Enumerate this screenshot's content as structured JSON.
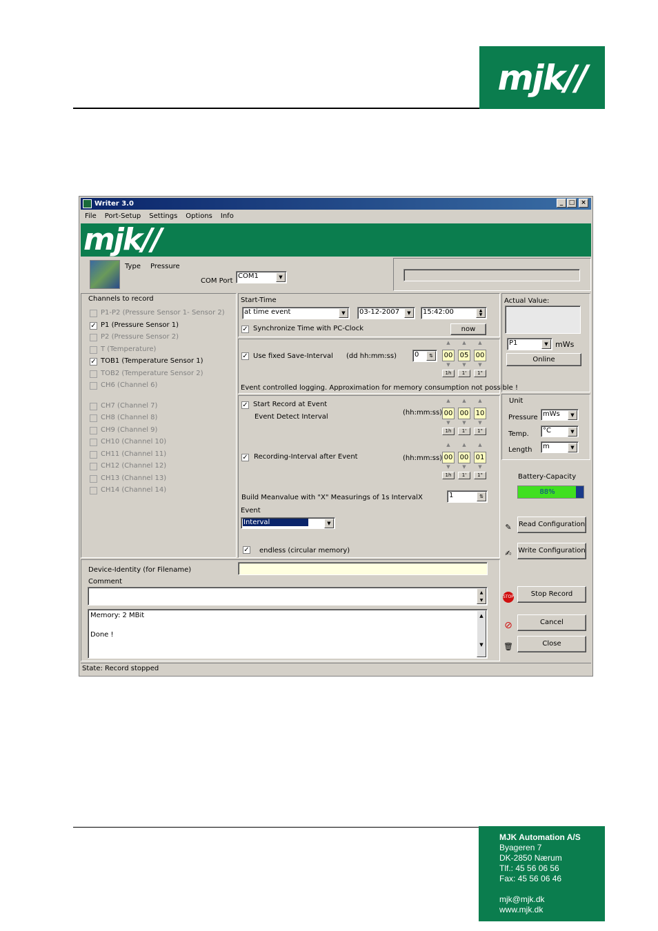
{
  "header": {
    "logo": "mjk//"
  },
  "window": {
    "title": "Writer 3.0",
    "controls": {
      "min": "_",
      "max": "□",
      "close": "×"
    },
    "menu": [
      "File",
      "Port-Setup",
      "Settings",
      "Options",
      "Info"
    ],
    "banner_logo": "mjk//",
    "type_label": "Type",
    "type_value": "Pressure",
    "com_label": "COM Port",
    "com_value": "COM1",
    "channels": {
      "title": "Channels to record",
      "items": [
        {
          "label": "P1-P2 (Pressure Sensor 1- Sensor 2)",
          "checked": false,
          "enabled": false
        },
        {
          "label": "P1 (Pressure Sensor 1)",
          "checked": true,
          "enabled": true
        },
        {
          "label": "P2 (Pressure Sensor 2)",
          "checked": false,
          "enabled": false
        },
        {
          "label": "T (Temperature)",
          "checked": false,
          "enabled": false
        },
        {
          "label": "TOB1 (Temperature Sensor 1)",
          "checked": true,
          "enabled": true
        },
        {
          "label": "TOB2 (Temperature Sensor 2)",
          "checked": false,
          "enabled": false
        },
        {
          "label": "CH6 (Channel 6)",
          "checked": false,
          "enabled": false
        },
        {
          "label": "CH7 (Channel 7)",
          "checked": false,
          "enabled": false
        },
        {
          "label": "CH8 (Channel 8)",
          "checked": false,
          "enabled": false
        },
        {
          "label": "CH9 (Channel 9)",
          "checked": false,
          "enabled": false
        },
        {
          "label": "CH10 (Channel 10)",
          "checked": false,
          "enabled": false
        },
        {
          "label": "CH11 (Channel 11)",
          "checked": false,
          "enabled": false
        },
        {
          "label": "CH12 (Channel 12)",
          "checked": false,
          "enabled": false
        },
        {
          "label": "CH13 (Channel 13)",
          "checked": false,
          "enabled": false
        },
        {
          "label": "CH14 (Channel 14)",
          "checked": false,
          "enabled": false
        }
      ]
    },
    "start": {
      "title": "Start-Time",
      "mode": "at time event",
      "date": "03-12-2007",
      "time": "15:42:00",
      "sync_label": "Synchronize Time with PC-Clock",
      "now_label": "now"
    },
    "save": {
      "label": "Use fixed Save-Interval",
      "format": "(dd hh:mm:ss)",
      "days": "0",
      "h": "00",
      "m": "05",
      "s": "00",
      "note": "Event controlled logging. Approximation for memory consumption not possible !"
    },
    "spin": {
      "up": "▲",
      "down": "▼",
      "b1": "1h",
      "b2": "1'",
      "b3": "1\""
    },
    "event": {
      "start_label": "Start Record at Event",
      "detect_label": "Event Detect Interval",
      "format": "(hh:mm:ss)",
      "h": "00",
      "m": "00",
      "s": "10",
      "rec_label": "Recording-Interval after Event",
      "rec_format": "(hh:mm:ss)",
      "rh": "00",
      "rm": "00",
      "rs": "01",
      "mean_label": "Build Meanvalue with \"X\" Measurings of 1s Interval",
      "x": "X",
      "mean_value": "1",
      "event_label": "Event",
      "event_value": "Interval",
      "endless_label": "endless (circular memory)"
    },
    "actual": {
      "title": "Actual Value:",
      "channel": "P1",
      "unit": "mWs",
      "online": "Online"
    },
    "units": {
      "title": "Unit",
      "pressure_label": "Pressure",
      "pressure": "mWs",
      "temp_label": "Temp.",
      "temp": "°C",
      "length_label": "Length",
      "length": "m"
    },
    "battery": {
      "title": "Battery-Capacity",
      "value": "88%",
      "percent": 88
    },
    "buttons": {
      "read": "Read Configuration",
      "write": "Write Configuration",
      "stop": "Stop Record",
      "cancel": "Cancel",
      "close": "Close"
    },
    "device": {
      "label": "Device-Identity (for Filename)",
      "comment_label": "Comment"
    },
    "log": {
      "line1": "Memory: 2 MBit",
      "line2": "Done !"
    },
    "status": "State: Record stopped"
  },
  "footer": {
    "company": "MJK Automation A/S",
    "street": "Byageren 7",
    "city": "DK-2850 Nærum",
    "tlf": "Tlf.:  45 56 06 56",
    "fax": "Fax:  45 56 06 46",
    "email": "mjk@mjk.dk",
    "web": "www.mjk.dk"
  },
  "colors": {
    "brand": "#0b7d4e",
    "title_bar": "#0a246a",
    "battery": "#40e020"
  }
}
